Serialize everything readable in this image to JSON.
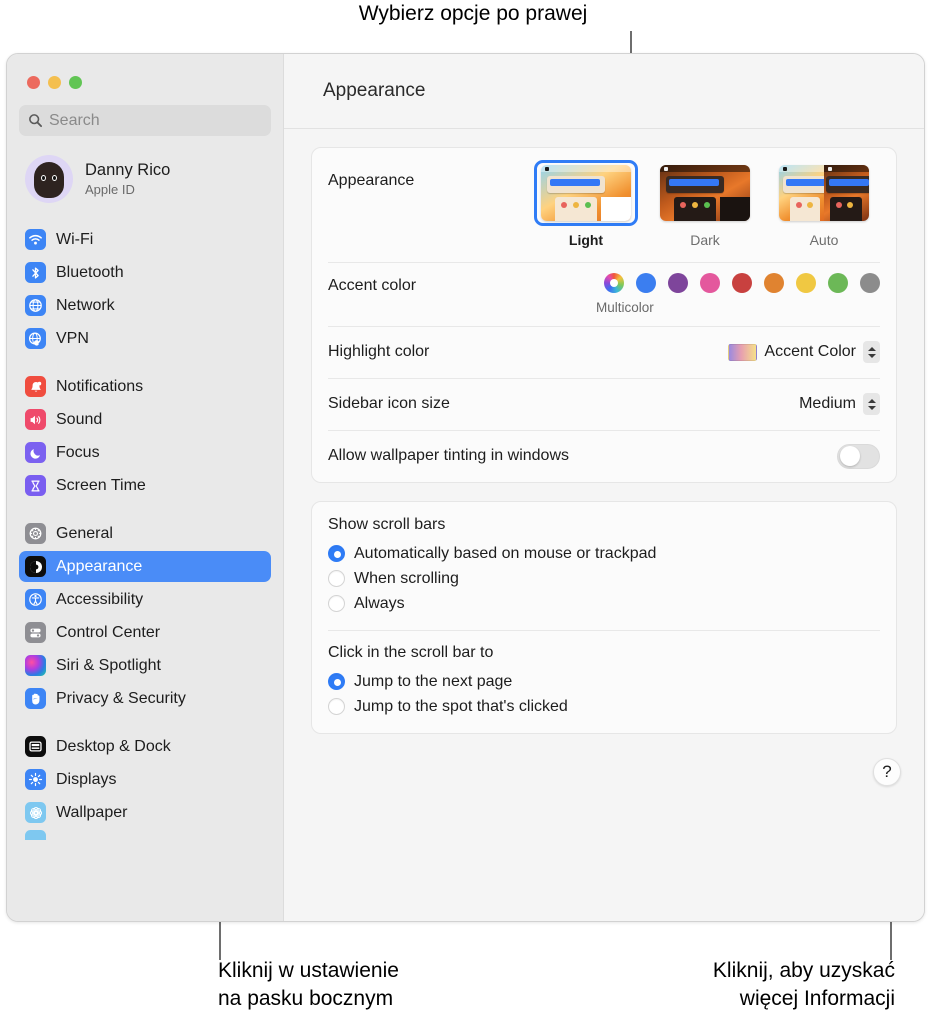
{
  "callouts": {
    "top": "Wybierz opcje po prawej",
    "bottom_left": "Kliknij w ustawienie\nna pasku bocznym",
    "bottom_right": "Kliknij, aby uzyskać\nwięcej Informacji"
  },
  "window": {
    "title": "Appearance"
  },
  "sidebar": {
    "search": {
      "placeholder": "Search",
      "icon": "search-icon"
    },
    "profile": {
      "name": "Danny Rico",
      "subtitle": "Apple ID",
      "icon": "avatar"
    },
    "groups": [
      {
        "items": [
          {
            "label": "Wi-Fi",
            "icon": "wifi-icon",
            "selected": false
          },
          {
            "label": "Bluetooth",
            "icon": "bluetooth-icon",
            "selected": false
          },
          {
            "label": "Network",
            "icon": "network-icon",
            "selected": false
          },
          {
            "label": "VPN",
            "icon": "vpn-icon",
            "selected": false
          }
        ]
      },
      {
        "items": [
          {
            "label": "Notifications",
            "icon": "bell-icon",
            "selected": false
          },
          {
            "label": "Sound",
            "icon": "speaker-icon",
            "selected": false
          },
          {
            "label": "Focus",
            "icon": "moon-icon",
            "selected": false
          },
          {
            "label": "Screen Time",
            "icon": "hourglass-icon",
            "selected": false
          }
        ]
      },
      {
        "items": [
          {
            "label": "General",
            "icon": "gear-icon",
            "selected": false
          },
          {
            "label": "Appearance",
            "icon": "contrast-icon",
            "selected": true
          },
          {
            "label": "Accessibility",
            "icon": "accessibility-icon",
            "selected": false
          },
          {
            "label": "Control Center",
            "icon": "sliders-icon",
            "selected": false
          },
          {
            "label": "Siri & Spotlight",
            "icon": "siri-icon",
            "selected": false
          },
          {
            "label": "Privacy & Security",
            "icon": "hand-icon",
            "selected": false
          }
        ]
      },
      {
        "items": [
          {
            "label": "Desktop & Dock",
            "icon": "desktop-icon",
            "selected": false
          },
          {
            "label": "Displays",
            "icon": "brightness-icon",
            "selected": false
          },
          {
            "label": "Wallpaper",
            "icon": "flower-icon",
            "selected": false
          }
        ]
      }
    ]
  },
  "main": {
    "appearance": {
      "label": "Appearance",
      "options": [
        {
          "name": "Light",
          "selected": true
        },
        {
          "name": "Dark",
          "selected": false
        },
        {
          "name": "Auto",
          "selected": false
        }
      ]
    },
    "accent_color": {
      "label": "Accent color",
      "caption": "Multicolor",
      "swatches": [
        {
          "name": "Multicolor",
          "color": "multicolor",
          "selected": true
        },
        {
          "name": "Blue",
          "color": "#3b7ef0",
          "selected": false
        },
        {
          "name": "Purple",
          "color": "#7e459b",
          "selected": false
        },
        {
          "name": "Pink",
          "color": "#e4589d",
          "selected": false
        },
        {
          "name": "Red",
          "color": "#c8413f",
          "selected": false
        },
        {
          "name": "Orange",
          "color": "#e08330",
          "selected": false
        },
        {
          "name": "Yellow",
          "color": "#f0c842",
          "selected": false
        },
        {
          "name": "Green",
          "color": "#6cb857",
          "selected": false
        },
        {
          "name": "Graphite",
          "color": "#8c8c8c",
          "selected": false
        }
      ]
    },
    "highlight_color": {
      "label": "Highlight color",
      "value": "Accent Color"
    },
    "sidebar_icon_size": {
      "label": "Sidebar icon size",
      "value": "Medium"
    },
    "wallpaper_tinting": {
      "label": "Allow wallpaper tinting in windows",
      "value": "off"
    },
    "show_scroll_bars": {
      "title": "Show scroll bars",
      "options": [
        {
          "label": "Automatically based on mouse or trackpad",
          "selected": true
        },
        {
          "label": "When scrolling",
          "selected": false
        },
        {
          "label": "Always",
          "selected": false
        }
      ]
    },
    "click_scroll_bar": {
      "title": "Click in the scroll bar to",
      "options": [
        {
          "label": "Jump to the next page",
          "selected": true
        },
        {
          "label": "Jump to the spot that's clicked",
          "selected": false
        }
      ]
    },
    "help_button": {
      "label": "?"
    }
  }
}
